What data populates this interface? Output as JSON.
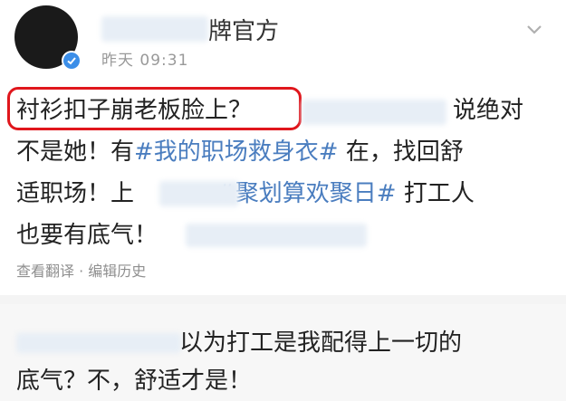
{
  "author": {
    "name_suffix": "牌官方",
    "time": "昨天 09:31"
  },
  "post": {
    "highlight_text": "衬衫扣子崩老板脸上？",
    "line1_rest": "说绝对",
    "line2_a": "不是她！有",
    "line2_tag": "#我的职场救身衣#",
    "line2_b": " 在，找回舒",
    "line3_a": "适职场！上",
    "line3_tag": "#聚划算欢聚日#",
    "line3_b": " 打工人",
    "line4_a": "也要有底气！"
  },
  "meta": {
    "translate": "查看翻译",
    "separator": " · ",
    "edit_history": "编辑历史"
  },
  "comment": {
    "line1_tail": "以为打工是我配得上一切的",
    "line2": "底气？不，舒适才是！"
  },
  "icons": {
    "verified": "verified-badge-icon",
    "menu": "chevron-down-icon"
  },
  "colors": {
    "highlight_border": "#e0161c",
    "hashtag": "#4a7dbf",
    "verified": "#3b8ee8"
  }
}
